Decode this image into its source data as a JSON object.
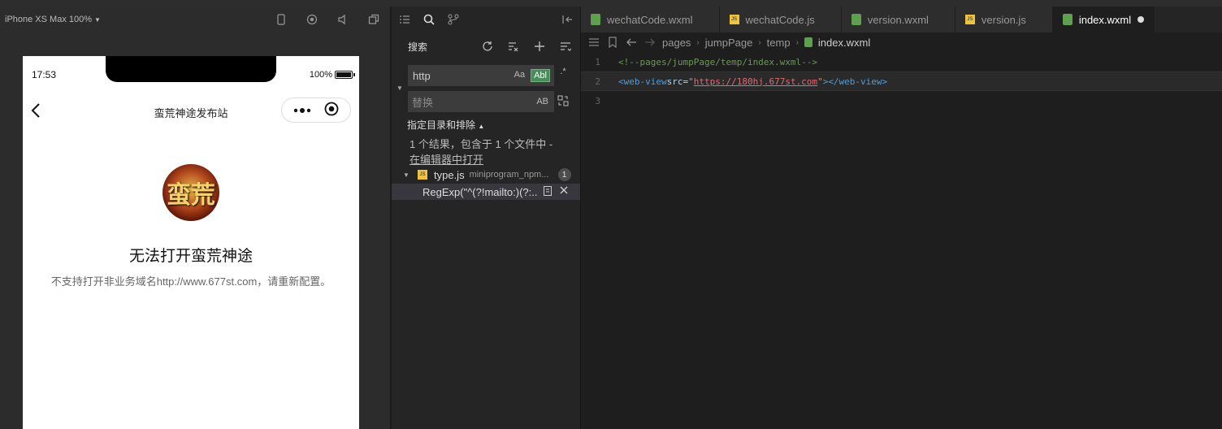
{
  "simulator": {
    "device_label": "iPhone XS Max 100%",
    "status_time": "17:53",
    "battery_text": "100%",
    "battery_level": 1.0,
    "nav_title": "蛮荒神途发布站",
    "logo_text": "蛮荒",
    "error_title": "无法打开蛮荒神途",
    "error_desc": "不支持打开非业务域名http://www.677st.com，请重新配置。"
  },
  "search": {
    "panel_title": "搜索",
    "query": "http",
    "replace_placeholder": "替换",
    "opt_case": "Aa",
    "opt_word": "Abl",
    "opt_regex": ".*",
    "opt_preserve_case": "AB",
    "scope_label": "指定目录和排除",
    "result_summary": "1 个结果，包含于 1 个文件中 -",
    "open_in_editor": "在编辑器中打开",
    "file": {
      "name": "type.js",
      "path": "miniprogram_npm...",
      "count": "1",
      "icon_text": "JS"
    },
    "match_text": "RegExp(\"^(?!mailto:)(?:..."
  },
  "editor": {
    "tabs": [
      {
        "label": "wechatCode.wxml",
        "type": "wxml"
      },
      {
        "label": "wechatCode.js",
        "type": "js"
      },
      {
        "label": "version.wxml",
        "type": "wxml"
      },
      {
        "label": "version.js",
        "type": "js"
      },
      {
        "label": "index.wxml",
        "type": "wxml",
        "active": true
      }
    ],
    "breadcrumb": [
      "pages",
      "jumpPage",
      "temp",
      "index.wxml"
    ],
    "lines": {
      "n1": "1",
      "n2": "2",
      "n3": "3",
      "comment": "<!--pages/jumpPage/temp/index.wxml-->",
      "tag_open": "<web-view",
      "attr": " src=",
      "quote": "\"",
      "url": "https://180hj.677st.com",
      "close_open": ">",
      "tag_close": "</web-view>"
    }
  }
}
